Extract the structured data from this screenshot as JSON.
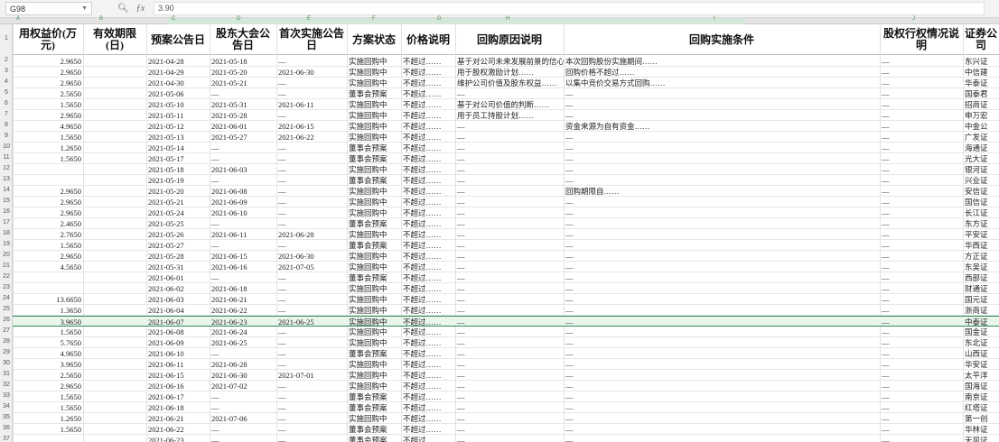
{
  "toolbar": {
    "name_box": "G98",
    "formula_value": "3.90",
    "fx_icon": "magnifier-icon",
    "func_icon": "fx-icon"
  },
  "column_letters": [
    "A",
    "B",
    "C",
    "D",
    "E",
    "F",
    "G",
    "H",
    "I",
    "J"
  ],
  "headers": [
    "用权益价(万元)",
    "有效期限(日)",
    "预案公告日",
    "股东大会公告日",
    "首次实施公告日",
    "方案状态",
    "价格说明",
    "回购原因说明",
    "回购实施条件",
    "股权行权情况说明",
    "证券公司"
  ],
  "row_numbers": [
    "1",
    "2",
    "3",
    "4",
    "5",
    "6",
    "7",
    "8",
    "9",
    "10",
    "11",
    "12",
    "13",
    "14",
    "15",
    "16",
    "17",
    "18",
    "19",
    "20",
    "21",
    "22",
    "23",
    "24",
    "25",
    "26",
    "27",
    "28",
    "29",
    "30",
    "31",
    "32",
    "33",
    "34",
    "35",
    "36",
    "37",
    "38"
  ],
  "rows": [
    [
      "2.9650",
      "",
      "2021-04-28",
      "2021-05-18",
      "—",
      "实施回购中",
      "不超过……",
      "基于对公司未来发展前景的信心……",
      "本次回购股份实施期间……",
      "—",
      "东兴证"
    ],
    [
      "2.9650",
      "",
      "2021-04-29",
      "2021-05-20",
      "2021-06-30",
      "实施回购中",
      "不超过……",
      "用于股权激励计划……",
      "回购价格不超过……",
      "—",
      "中信建"
    ],
    [
      "2.9650",
      "",
      "2021-04-30",
      "2021-05-21",
      "—",
      "实施回购中",
      "不超过……",
      "维护公司价值及股东权益……",
      "以集中竞价交易方式回购……",
      "—",
      "华泰证"
    ],
    [
      "2.5650",
      "",
      "2021-05-06",
      "—",
      "—",
      "董事会预案",
      "不超过……",
      "—",
      "—",
      "—",
      "国泰君"
    ],
    [
      "1.5650",
      "",
      "2021-05-10",
      "2021-05-31",
      "2021-06-11",
      "实施回购中",
      "不超过……",
      "基于对公司价值的判断……",
      "—",
      "—",
      "招商证"
    ],
    [
      "2.9650",
      "",
      "2021-05-11",
      "2021-05-28",
      "—",
      "实施回购中",
      "不超过……",
      "用于员工持股计划……",
      "—",
      "—",
      "申万宏"
    ],
    [
      "4.9650",
      "",
      "2021-05-12",
      "2021-06-01",
      "2021-06-15",
      "实施回购中",
      "不超过……",
      "—",
      "资金来源为自有资金……",
      "—",
      "中金公"
    ],
    [
      "1.5650",
      "",
      "2021-05-13",
      "2021-05-27",
      "2021-06-22",
      "实施回购中",
      "不超过……",
      "—",
      "—",
      "—",
      "广发证"
    ],
    [
      "1.2650",
      "",
      "2021-05-14",
      "—",
      "—",
      "董事会预案",
      "不超过……",
      "—",
      "—",
      "—",
      "海通证"
    ],
    [
      "1.5650",
      "",
      "2021-05-17",
      "—",
      "—",
      "董事会预案",
      "不超过……",
      "—",
      "—",
      "—",
      "光大证"
    ],
    [
      "",
      "",
      "2021-05-18",
      "2021-06-03",
      "—",
      "实施回购中",
      "不超过……",
      "—",
      "—",
      "—",
      "银河证"
    ],
    [
      "",
      "",
      "2021-05-19",
      "—",
      "—",
      "董事会预案",
      "不超过……",
      "—",
      "—",
      "—",
      "兴业证"
    ],
    [
      "2.9650",
      "",
      "2021-05-20",
      "2021-06-08",
      "—",
      "实施回购中",
      "不超过……",
      "—",
      "回购期限自……",
      "—",
      "安信证"
    ],
    [
      "2.9650",
      "",
      "2021-05-21",
      "2021-06-09",
      "—",
      "实施回购中",
      "不超过……",
      "—",
      "—",
      "—",
      "国信证"
    ],
    [
      "2.9650",
      "",
      "2021-05-24",
      "2021-06-10",
      "—",
      "实施回购中",
      "不超过……",
      "—",
      "—",
      "—",
      "长江证"
    ],
    [
      "2.4650",
      "",
      "2021-05-25",
      "—",
      "—",
      "董事会预案",
      "不超过……",
      "—",
      "—",
      "—",
      "东方证"
    ],
    [
      "2.7650",
      "",
      "2021-05-26",
      "2021-06-11",
      "2021-06-28",
      "实施回购中",
      "不超过……",
      "—",
      "—",
      "—",
      "平安证"
    ],
    [
      "1.5650",
      "",
      "2021-05-27",
      "—",
      "—",
      "董事会预案",
      "不超过……",
      "—",
      "—",
      "—",
      "华西证"
    ],
    [
      "2.9650",
      "",
      "2021-05-28",
      "2021-06-15",
      "2021-06-30",
      "实施回购中",
      "不超过……",
      "—",
      "—",
      "—",
      "方正证"
    ],
    [
      "4.5650",
      "",
      "2021-05-31",
      "2021-06-16",
      "2021-07-05",
      "实施回购中",
      "不超过……",
      "—",
      "—",
      "—",
      "东吴证"
    ],
    [
      "",
      "",
      "2021-06-01",
      "—",
      "—",
      "董事会预案",
      "不超过……",
      "—",
      "—",
      "—",
      "西部证"
    ],
    [
      "",
      "",
      "2021-06-02",
      "2021-06-18",
      "—",
      "实施回购中",
      "不超过……",
      "—",
      "—",
      "—",
      "财通证"
    ],
    [
      "13.6650",
      "",
      "2021-06-03",
      "2021-06-21",
      "—",
      "实施回购中",
      "不超过……",
      "—",
      "—",
      "—",
      "国元证"
    ],
    [
      "1.3650",
      "",
      "2021-06-04",
      "2021-06-22",
      "—",
      "实施回购中",
      "不超过……",
      "—",
      "—",
      "—",
      "浙商证"
    ],
    [
      "3.9650",
      "",
      "2021-06-07",
      "2021-06-23",
      "2021-06-25",
      "实施回购中",
      "不超过……",
      "—",
      "—",
      "—",
      "中泰证"
    ],
    [
      "1.5650",
      "",
      "2021-06-08",
      "2021-06-24",
      "—",
      "实施回购中",
      "不超过……",
      "—",
      "—",
      "—",
      "国金证"
    ],
    [
      "5.7650",
      "",
      "2021-06-09",
      "2021-06-25",
      "—",
      "实施回购中",
      "不超过……",
      "—",
      "—",
      "—",
      "东北证"
    ],
    [
      "4.9650",
      "",
      "2021-06-10",
      "—",
      "—",
      "董事会预案",
      "不超过……",
      "—",
      "—",
      "—",
      "山西证"
    ],
    [
      "3.9650",
      "",
      "2021-06-11",
      "2021-06-28",
      "—",
      "实施回购中",
      "不超过……",
      "—",
      "—",
      "—",
      "华安证"
    ],
    [
      "2.5650",
      "",
      "2021-06-15",
      "2021-06-30",
      "2021-07-01",
      "实施回购中",
      "不超过……",
      "—",
      "—",
      "—",
      "太平洋"
    ],
    [
      "2.9650",
      "",
      "2021-06-16",
      "2021-07-02",
      "—",
      "实施回购中",
      "不超过……",
      "—",
      "—",
      "—",
      "国海证"
    ],
    [
      "1.5650",
      "",
      "2021-06-17",
      "—",
      "—",
      "董事会预案",
      "不超过……",
      "—",
      "—",
      "—",
      "南京证"
    ],
    [
      "1.5650",
      "",
      "2021-06-18",
      "—",
      "—",
      "董事会预案",
      "不超过……",
      "—",
      "—",
      "—",
      "红塔证"
    ],
    [
      "1.2650",
      "",
      "2021-06-21",
      "2021-07-06",
      "—",
      "实施回购中",
      "不超过……",
      "—",
      "—",
      "—",
      "第一创"
    ],
    [
      "1.5650",
      "",
      "2021-06-22",
      "—",
      "—",
      "董事会预案",
      "不超过……",
      "—",
      "—",
      "—",
      "华林证"
    ],
    [
      "",
      "",
      "2021-06-23",
      "—",
      "—",
      "董事会预案",
      "不超过……",
      "—",
      "—",
      "—",
      "天风证"
    ]
  ],
  "selected_row_index": 24
}
